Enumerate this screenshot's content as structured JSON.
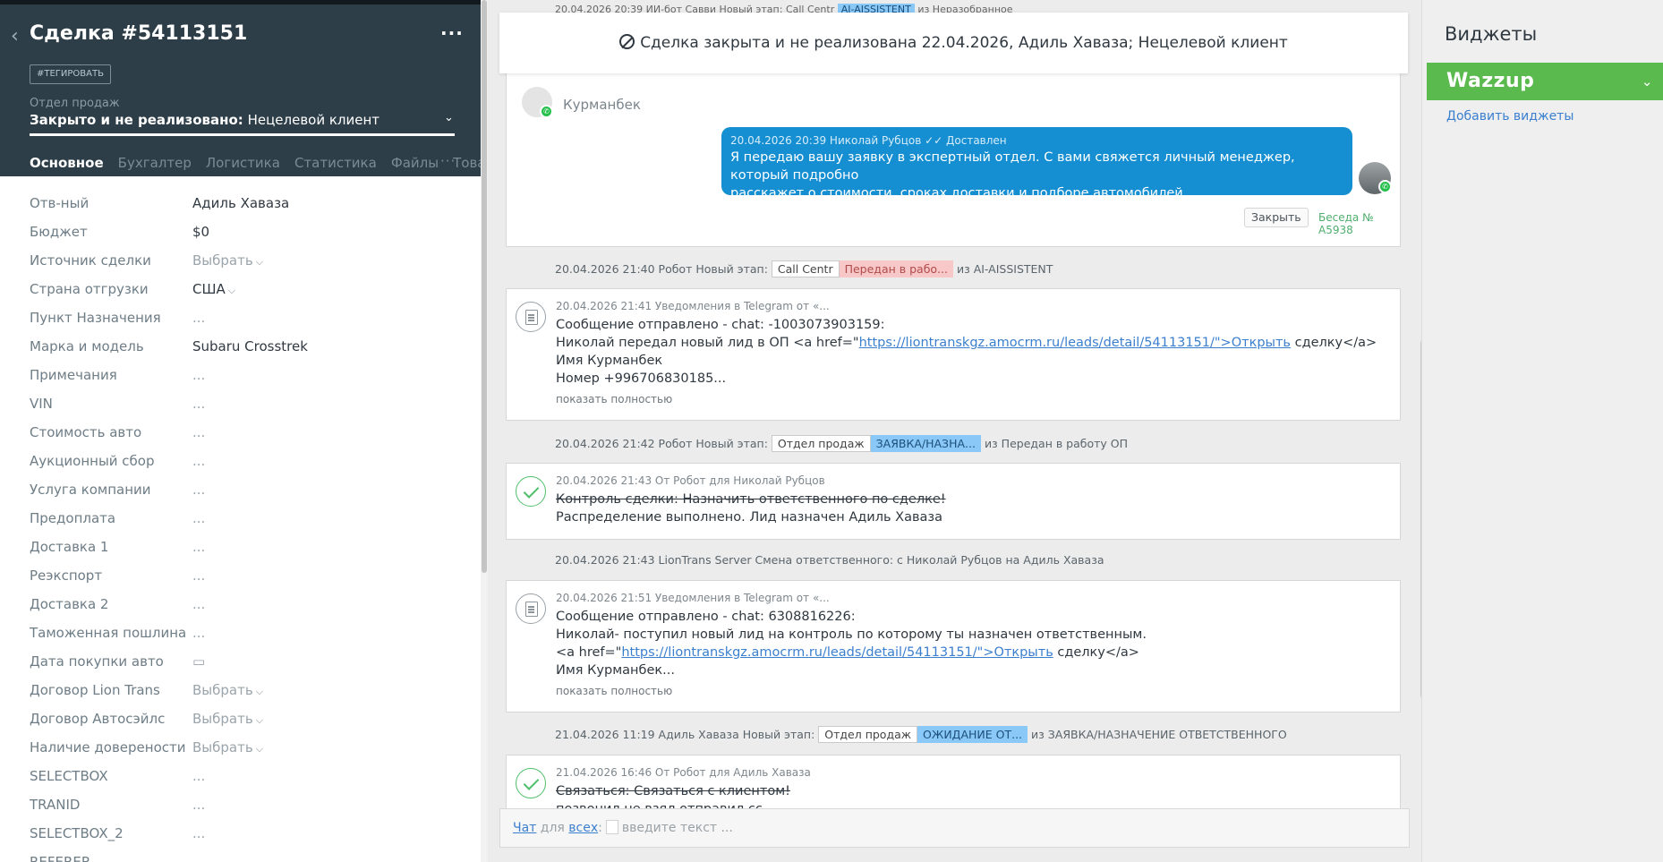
{
  "lead": {
    "title": "Сделка #54113151",
    "tag_button": "#ТЕГИРОВАТЬ",
    "pipeline": "Отдел продаж",
    "status_bold": "Закрыто и не реализовано:",
    "status_reason": " Нецелевой клиент",
    "tabs": [
      "Основное",
      "Бухгалтер",
      "Логистика",
      "Статистика",
      "Файлы",
      "Товары"
    ],
    "more": "···"
  },
  "fields": [
    {
      "name": "Отв-ный",
      "value": "Адиль Хаваза"
    },
    {
      "name": "Бюджет",
      "value": "$0"
    },
    {
      "name": "Источник сделки",
      "value": "Выбрать"
    },
    {
      "name": "Страна отгрузки",
      "value": "США"
    },
    {
      "name": "Пункт Назначения",
      "value": "..."
    },
    {
      "name": "Марка и модель",
      "value": "Subaru Crosstrek"
    },
    {
      "name": "Примечания",
      "value": "..."
    },
    {
      "name": "VIN",
      "value": "..."
    },
    {
      "name": "Стоимость авто",
      "value": "..."
    },
    {
      "name": "Аукционный сбор",
      "value": "..."
    },
    {
      "name": "Услуга компании",
      "value": "..."
    },
    {
      "name": "Предоплата",
      "value": "..."
    },
    {
      "name": "Доставка 1",
      "value": "..."
    },
    {
      "name": "Реэкспорт",
      "value": "..."
    },
    {
      "name": "Доставка 2",
      "value": "..."
    },
    {
      "name": "Таможенная пошлина",
      "value": "..."
    },
    {
      "name": "Дата покупки авто",
      "value": "▭"
    },
    {
      "name": "Договор Lion Trans",
      "value": "Выбрать"
    },
    {
      "name": "Договор Автосэйлс",
      "value": "Выбрать"
    },
    {
      "name": "Наличие доверености",
      "value": "Выбрать"
    },
    {
      "name": "SELECTBOX",
      "value": "..."
    },
    {
      "name": "TRANID",
      "value": "..."
    },
    {
      "name": "SELECTBOX_2",
      "value": "..."
    },
    {
      "name": "REFERER",
      "value": ""
    }
  ],
  "feed": {
    "top_peek": "20.04.2026 20:39 ИИ-бот Савви Новый этап: Call Centr",
    "top_peek_chip": "AI-AISSISTENT",
    "top_peek_tail": "из Неразобранное",
    "closed_banner": "Сделка закрыта и не реализована 22.04.2026, Адиль Хаваза; Нецелевой клиент",
    "chat": {
      "contact": "Курманбек",
      "meta": "20.04.2026 20:39 Николай Рубцов ✓✓ Доставлен",
      "line1": "Я передаю вашу заявку в экспертный отдел. С вами свяжется личный менеджер, который подробно",
      "line2": "расскажет о стоимости, сроках доставки и подборе автомобилей.",
      "close": "Закрыть",
      "conversation": "Беседа № A5938"
    },
    "event1": {
      "text": "20.04.2026 21:40 Робот Новый этап:",
      "chip1": "Call Centr",
      "chip2": "Передан в рабо...",
      "tail": "из AI-AISSISTENT"
    },
    "note1": {
      "meta": "20.04.2026 21:41 Уведомления в Telegram от «...",
      "l1": "Сообщение отправлено - chat: -1003073903159:",
      "l2a": "Николай передал новый лид в ОП <a href=\"",
      "l2link": "https://liontranskgz.amocrm.ru/leads/detail/54113151/\">Открыть",
      "l2b": " сделку</a>",
      "l3": "Имя Курманбек",
      "l4": "Номер +996706830185...",
      "more": "показать полностью"
    },
    "event2": {
      "text": "20.04.2026 21:42 Робот Новый этап:",
      "chip1": "Отдел продаж",
      "chip2": "ЗАЯВКА/НАЗНА...",
      "tail": "из Передан в работу ОП"
    },
    "task1": {
      "meta": "20.04.2026 21:43  От Робот для Николай Рубцов",
      "l1": "Контроль сделки: Назначить ответственного по сделке!",
      "l2": "Распределение выполнено. Лид назначен Адиль Хаваза"
    },
    "event3": {
      "text": "20.04.2026 21:43 LionTrans Server Смена ответственного: с Николай Рубцов на Адиль Хаваза"
    },
    "note2": {
      "meta": "20.04.2026 21:51 Уведомления в Telegram от «...",
      "l1": "Сообщение отправлено - chat: 6308816226:",
      "l2": "Николай- поступил новый лид на контроль по которому ты назначен ответственным.",
      "l3a": "<a href=\"",
      "l3link": "https://liontranskgz.amocrm.ru/leads/detail/54113151/\">Открыть",
      "l3b": " сделку</a>",
      "l4": "Имя Курманбек...",
      "more": "показать полностью"
    },
    "event4": {
      "text": "21.04.2026 11:19 Адиль Хаваза Новый этап:",
      "chip1": "Отдел продаж",
      "chip2": "ОЖИДАНИЕ ОТ...",
      "tail": "из ЗАЯВКА/НАЗНАЧЕНИЕ ОТВЕТСТВЕННОГО"
    },
    "task2": {
      "meta": "21.04.2026 16:46  От Робот для Адиль Хаваза",
      "l1": "Связаться: Связаться с клиентом!",
      "l2": "позвонил не взял отправил сс"
    },
    "input": {
      "chat": "Чат",
      "for": " для ",
      "all": "всех",
      "placeholder": "введите текст ..."
    }
  },
  "widgets": {
    "title": "Виджеты",
    "wazzup": "Wazzup",
    "add": "Добавить виджеты"
  }
}
